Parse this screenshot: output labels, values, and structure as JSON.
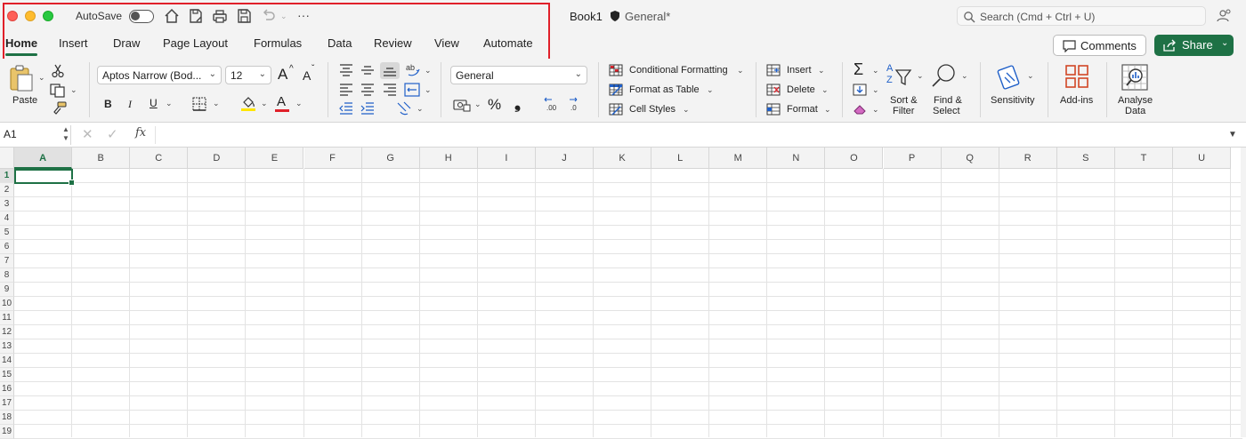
{
  "titlebar": {
    "autosave_label": "AutoSave",
    "document_title": "Book1",
    "sensitivity": "General*",
    "search_placeholder": "Search (Cmd + Ctrl + U)",
    "more": "···"
  },
  "tabs": [
    {
      "label": "Home"
    },
    {
      "label": "Insert"
    },
    {
      "label": "Draw"
    },
    {
      "label": "Page Layout"
    },
    {
      "label": "Formulas"
    },
    {
      "label": "Data"
    },
    {
      "label": "Review"
    },
    {
      "label": "View"
    },
    {
      "label": "Automate"
    }
  ],
  "actions": {
    "comments": "Comments",
    "share": "Share"
  },
  "ribbon": {
    "paste": "Paste",
    "font_name": "Aptos Narrow (Bod...",
    "font_size": "12",
    "bold": "B",
    "italic": "I",
    "underline": "U",
    "number_format": "General",
    "percent": "%",
    "comma": "❟",
    "conditional_formatting": "Conditional Formatting",
    "format_as_table": "Format as Table",
    "cell_styles": "Cell Styles",
    "insert": "Insert",
    "delete": "Delete",
    "format": "Format",
    "sort_filter": [
      "Sort &",
      "Filter"
    ],
    "find_select": [
      "Find &",
      "Select"
    ],
    "sensitivity": "Sensitivity",
    "add_ins": "Add-ins",
    "analyse_data": [
      "Analyse",
      "Data"
    ],
    "font_grow": "A",
    "font_shrink": "A",
    "font_color_letter": "A",
    "sort_letters": [
      "A",
      "Z"
    ]
  },
  "formula_bar": {
    "name_box": "A1",
    "fx": "fx",
    "value": ""
  },
  "sheet": {
    "columns": [
      "A",
      "B",
      "C",
      "D",
      "E",
      "F",
      "G",
      "H",
      "I",
      "J",
      "K",
      "L",
      "M",
      "N",
      "O",
      "P",
      "Q",
      "R",
      "S",
      "T",
      "U"
    ],
    "rows": [
      "1",
      "2",
      "3",
      "4",
      "5",
      "6",
      "7",
      "8",
      "9",
      "10",
      "11",
      "12",
      "13",
      "14",
      "15",
      "16",
      "17",
      "18",
      "19"
    ],
    "selected_cell": "A1"
  },
  "colors": {
    "accent": "#1e7145",
    "highlight_box": "#e0202a"
  }
}
